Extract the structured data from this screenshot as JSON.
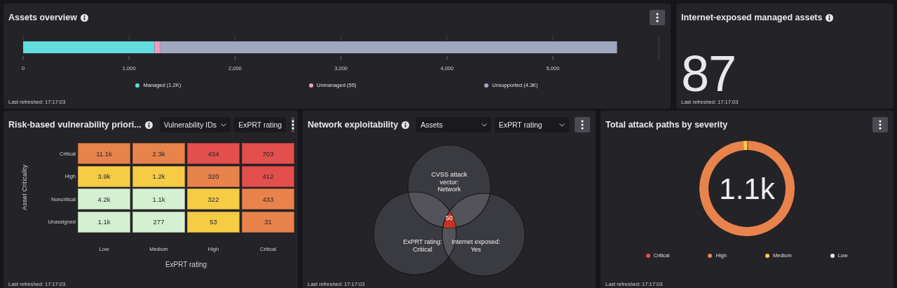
{
  "assets_overview": {
    "title": "Assets overview",
    "chart_data": {
      "type": "bar",
      "orientation": "horizontal",
      "stacked": true,
      "series": [
        {
          "name": "Managed (1.2K)",
          "color": "#62dcdc",
          "values": [
            1240
          ]
        },
        {
          "name": "Unmanaged (55)",
          "color": "#f09ac4",
          "values": [
            55
          ]
        },
        {
          "name": "Unsupported (4.3K)",
          "color": "#a0a8c0",
          "values": [
            4310
          ]
        }
      ],
      "xlim": [
        0,
        6000
      ],
      "xticks": [
        {
          "value": 0,
          "label": "0"
        },
        {
          "value": 1000,
          "label": "1,000"
        },
        {
          "value": 2000,
          "label": "2,000"
        },
        {
          "value": 3000,
          "label": "3,000"
        },
        {
          "value": 4000,
          "label": "4,000"
        },
        {
          "value": 5000,
          "label": "5,000"
        }
      ]
    },
    "footer": "Last refreshed: 17:17:03"
  },
  "internet_exposed": {
    "title": "Internet-exposed managed assets",
    "value": "87",
    "footer": "Last refreshed: 17:17:03"
  },
  "risk_matrix": {
    "title": "Risk-based vulnerability priori...",
    "selects": [
      {
        "value": "Vulnerability IDs",
        "caret": true
      },
      {
        "value": "ExPRT rating",
        "caret": false
      }
    ],
    "y_title": "Asset Criticality",
    "x_title": "ExPRT rating",
    "x_labels": [
      "Low",
      "Medium",
      "High",
      "Critical"
    ],
    "rows": [
      {
        "label": "Critical",
        "cells": [
          {
            "value": "11.1k",
            "color": "#e8834c"
          },
          {
            "value": "2.3k",
            "color": "#e8834c"
          },
          {
            "value": "434",
            "color": "#e34f4c"
          },
          {
            "value": "703",
            "color": "#e34f4c"
          }
        ]
      },
      {
        "label": "High",
        "cells": [
          {
            "value": "3.9k",
            "color": "#f7cc45"
          },
          {
            "value": "1.2k",
            "color": "#f7cc45"
          },
          {
            "value": "320",
            "color": "#e8834c"
          },
          {
            "value": "412",
            "color": "#e34f4c"
          }
        ]
      },
      {
        "label": "Noncritical",
        "cells": [
          {
            "value": "4.2k",
            "color": "#d4f0d0"
          },
          {
            "value": "1.1k",
            "color": "#d4f0d0"
          },
          {
            "value": "322",
            "color": "#f7cc45"
          },
          {
            "value": "433",
            "color": "#e8834c"
          }
        ]
      },
      {
        "label": "Unassigned",
        "cells": [
          {
            "value": "1.1k",
            "color": "#d4f0d0"
          },
          {
            "value": "277",
            "color": "#d4f0d0"
          },
          {
            "value": "53",
            "color": "#f7cc45"
          },
          {
            "value": "31",
            "color": "#e8834c"
          }
        ]
      }
    ],
    "footer": "Last refreshed: 17:17:03"
  },
  "network_exploitability": {
    "title": "Network exploitability",
    "selects": [
      {
        "value": "Assets",
        "caret": true
      },
      {
        "value": "ExPRT rating",
        "caret": true
      }
    ],
    "sets": [
      {
        "label": "CVSS attack vector: Network"
      },
      {
        "label": "ExPRT rating: Critical"
      },
      {
        "label": "Internet exposed: Yes"
      }
    ],
    "intersection": "50",
    "footer": "Last refreshed: 17:17:03"
  },
  "attack_paths": {
    "title": "Total attack paths by severity",
    "total": "1.1k",
    "chart_data": {
      "type": "donut",
      "categories": [
        "Critical",
        "High",
        "Medium",
        "Low"
      ],
      "values": [
        0.5,
        98.2,
        1.3,
        0
      ]
    },
    "legend": [
      {
        "color": "#e34f4c"
      },
      {
        "color": "#e8834c"
      },
      {
        "color": "#f7cc45"
      },
      {
        "color": "#d4f0d0"
      }
    ],
    "footer": "Last refreshed: 17:17:03"
  }
}
